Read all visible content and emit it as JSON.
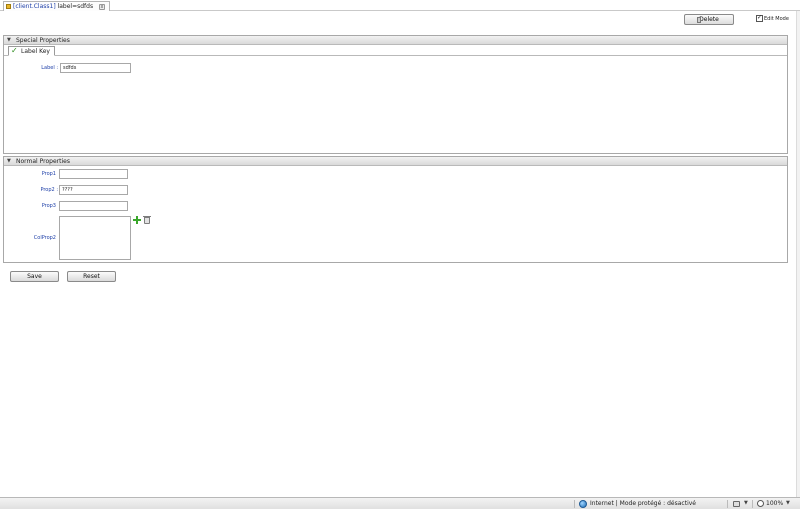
{
  "tab": {
    "class_text": "[client.Class1]",
    "label_text": " label=sdfds",
    "close_glyph": "x"
  },
  "toolbar": {
    "delete_label": "Delete",
    "edit_mode_label": "Edit Mode",
    "edit_mode_checked": true
  },
  "special_properties": {
    "header": "Special Properties",
    "subtab_label": "Label Key",
    "label_field": {
      "label": "Label :",
      "value": "sdfds"
    }
  },
  "normal_properties": {
    "header": "Normal Properties",
    "fields": [
      {
        "label": "Prop1",
        "value": ""
      },
      {
        "label": "Prop2 :",
        "value": "????"
      },
      {
        "label": "Prop3",
        "value": ""
      },
      {
        "label": "ColProp2",
        "value": ""
      }
    ]
  },
  "actions": {
    "save_label": "Save",
    "reset_label": "Reset"
  },
  "statusbar": {
    "zone_text": "Internet | Mode protégé : désactivé",
    "zoom_text": "100%"
  },
  "colors": {
    "link_label": "#1e3fa8",
    "add_green": "#3aa72b"
  }
}
